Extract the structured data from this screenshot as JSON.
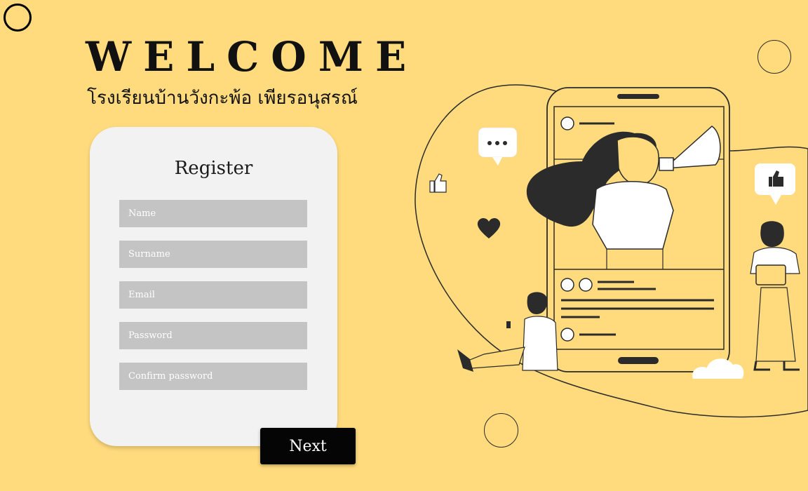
{
  "header": {
    "title": "WELCOME",
    "subtitle": "โรงเรียนบ้านวังกะพ้อ เพียรอนุสรณ์"
  },
  "form": {
    "title": "Register",
    "fields": [
      {
        "placeholder": "Name",
        "type": "text"
      },
      {
        "placeholder": "Surname",
        "type": "text"
      },
      {
        "placeholder": "Email",
        "type": "email"
      },
      {
        "placeholder": "Password",
        "type": "password"
      },
      {
        "placeholder": "Confirm password",
        "type": "password"
      }
    ],
    "next_label": "Next"
  },
  "colors": {
    "background": "#FFDB7D",
    "card": "#F2F2F2",
    "field": "#C4C4C4",
    "button": "#050505"
  },
  "illustration": {
    "icons": [
      "phone-icon",
      "megaphone-icon",
      "heart-icon",
      "thumbs-up-icon",
      "chat-bubble-icon",
      "cloud-icon"
    ]
  }
}
